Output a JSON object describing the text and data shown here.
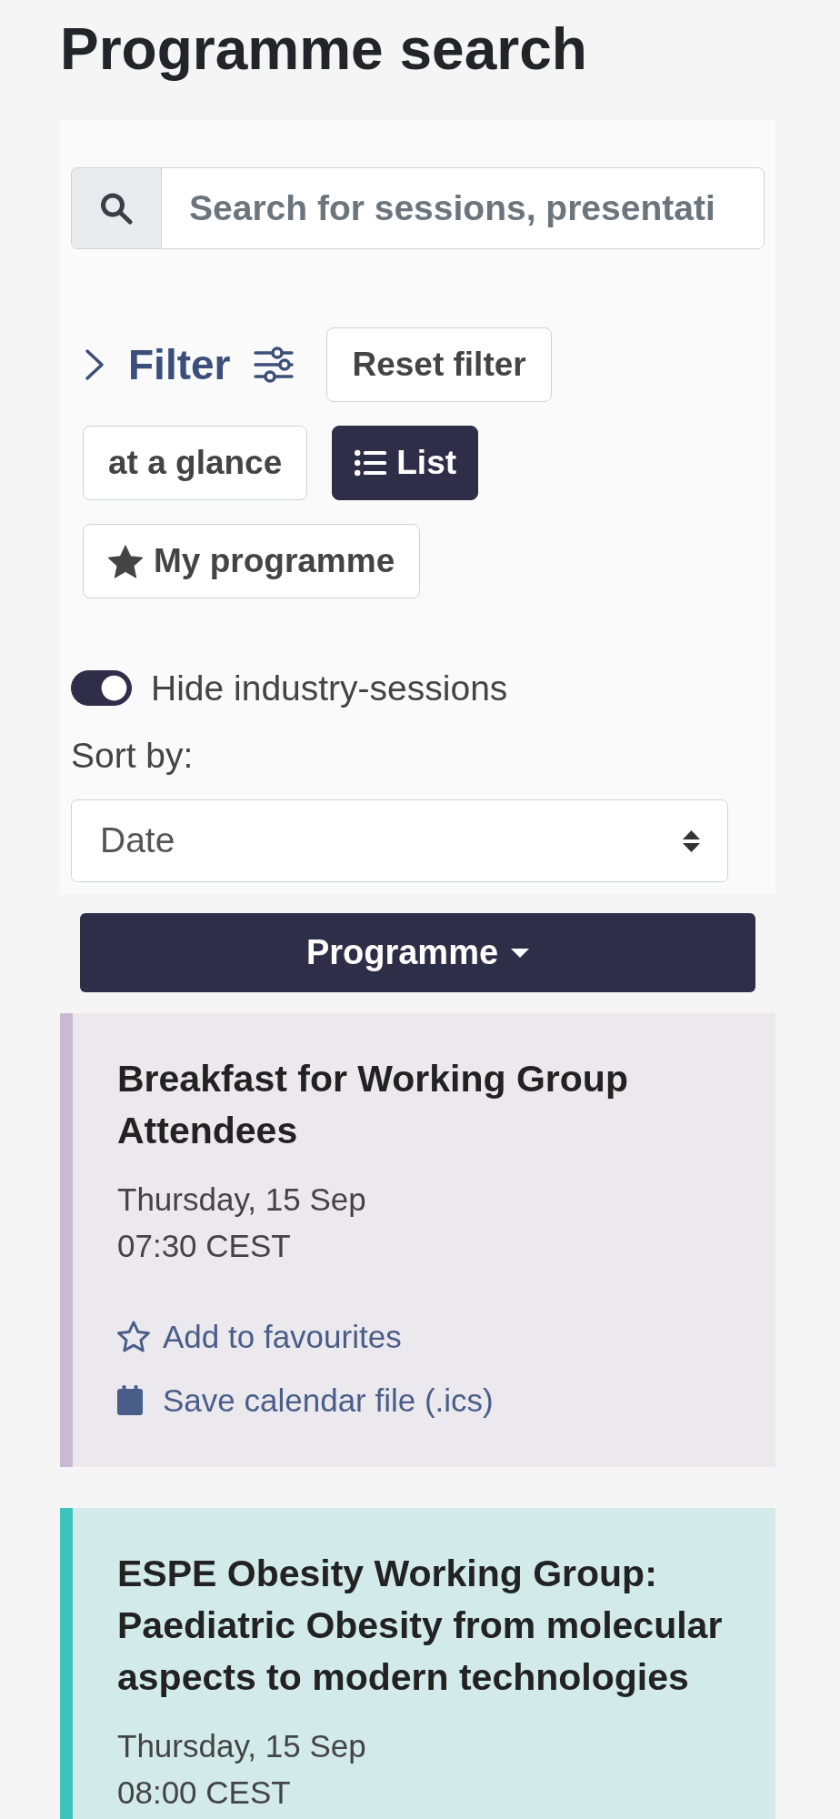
{
  "page": {
    "title": "Programme search"
  },
  "search": {
    "placeholder": "Search for sessions, presentati"
  },
  "filter": {
    "label": "Filter",
    "expanded": false,
    "reset_label": "Reset filter"
  },
  "views": [
    {
      "label": "at a glance",
      "kind": "glance",
      "selected": false
    },
    {
      "label": "List",
      "kind": "list",
      "selected": true
    },
    {
      "label": "My programme",
      "kind": "favourites",
      "selected": false
    }
  ],
  "industry_toggle": {
    "label": "Hide industry-sessions",
    "on": true
  },
  "sort": {
    "label": "Sort by:",
    "value": "Date"
  },
  "programme_menu": {
    "label": "Programme"
  },
  "sessions": [
    {
      "title": "Breakfast for Working Group Attendees",
      "date": "Thursday, 15 Sep",
      "time": "07:30 CEST",
      "color": "#c9b9d4",
      "actions": [
        {
          "kind": "favourite",
          "label": "Add to favourites"
        },
        {
          "kind": "calendar",
          "label": "Save calendar file (.ics)"
        }
      ]
    },
    {
      "title": "ESPE Obesity Working Group: Paediatric Obesity from molecular aspects to modern technologies",
      "date": "Thursday, 15 Sep",
      "time": "08:00 CEST",
      "color": "#3cc5bf"
    }
  ]
}
